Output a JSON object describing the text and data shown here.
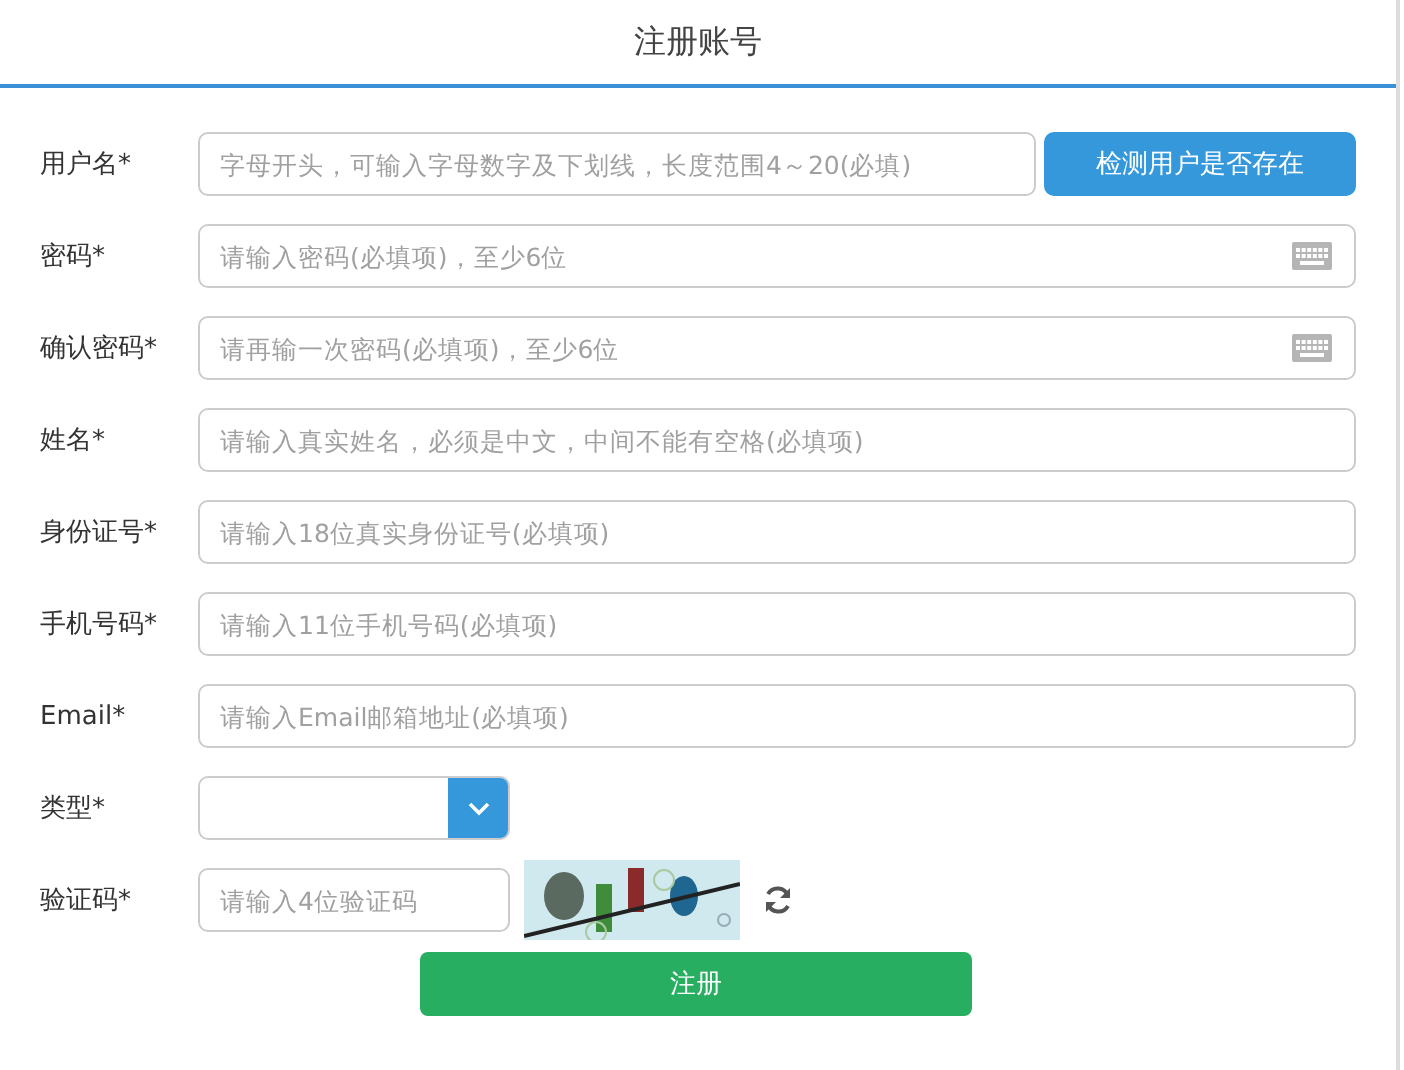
{
  "title": "注册账号",
  "fields": [
    {
      "kind": "text",
      "label": "用户名*",
      "placeholder": "字母开头，可输入字母数字及下划线，长度范围4～20(必填)",
      "button": "检测用户是否存在"
    },
    {
      "kind": "password",
      "label": "密码*",
      "placeholder": "请输入密码(必填项)，至少6位"
    },
    {
      "kind": "password",
      "label": "确认密码*",
      "placeholder": "请再输一次密码(必填项)，至少6位"
    },
    {
      "kind": "text",
      "label": "姓名*",
      "placeholder": "请输入真实姓名，必须是中文，中间不能有空格(必填项)"
    },
    {
      "kind": "text",
      "label": "身份证号*",
      "placeholder": "请输入18位真实身份证号(必填项)"
    },
    {
      "kind": "text",
      "label": "手机号码*",
      "placeholder": "请输入11位手机号码(必填项)"
    },
    {
      "kind": "text",
      "label": "Email*",
      "placeholder": "请输入Email邮箱地址(必填项)"
    },
    {
      "kind": "select",
      "label": "类型*"
    },
    {
      "kind": "captcha",
      "label": "验证码*",
      "placeholder": "请输入4位验证码"
    }
  ],
  "submit": "注册"
}
